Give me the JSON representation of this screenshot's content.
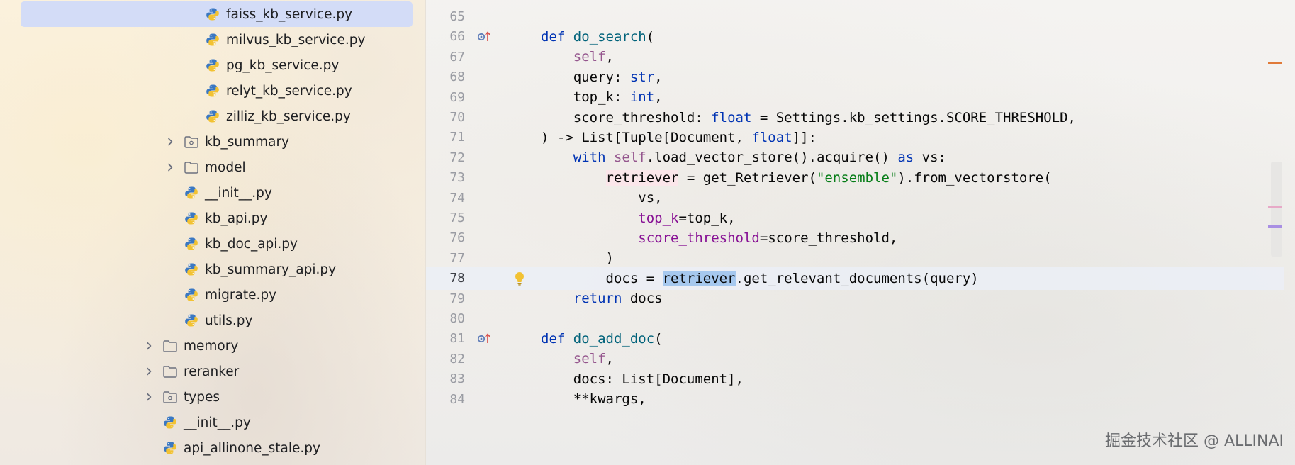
{
  "project_tree": {
    "items": [
      {
        "label": "faiss_kb_service.py",
        "kind": "python",
        "indent": 3,
        "selected": true
      },
      {
        "label": "milvus_kb_service.py",
        "kind": "python",
        "indent": 3
      },
      {
        "label": "pg_kb_service.py",
        "kind": "python",
        "indent": 3
      },
      {
        "label": "relyt_kb_service.py",
        "kind": "python",
        "indent": 3
      },
      {
        "label": "zilliz_kb_service.py",
        "kind": "python",
        "indent": 3
      },
      {
        "label": "kb_summary",
        "kind": "package",
        "indent": 2,
        "collapsed": true
      },
      {
        "label": "model",
        "kind": "folder",
        "indent": 2,
        "collapsed": true
      },
      {
        "label": "__init__.py",
        "kind": "python",
        "indent": 2
      },
      {
        "label": "kb_api.py",
        "kind": "python",
        "indent": 2
      },
      {
        "label": "kb_doc_api.py",
        "kind": "python",
        "indent": 2
      },
      {
        "label": "kb_summary_api.py",
        "kind": "python",
        "indent": 2
      },
      {
        "label": "migrate.py",
        "kind": "python",
        "indent": 2
      },
      {
        "label": "utils.py",
        "kind": "python",
        "indent": 2
      },
      {
        "label": "memory",
        "kind": "folder",
        "indent": 1,
        "collapsed": true
      },
      {
        "label": "reranker",
        "kind": "folder",
        "indent": 1,
        "collapsed": true
      },
      {
        "label": "types",
        "kind": "package",
        "indent": 1,
        "collapsed": true
      },
      {
        "label": "__init__.py",
        "kind": "python",
        "indent": 1
      },
      {
        "label": "api_allinone_stale.py",
        "kind": "python",
        "indent": 1
      }
    ]
  },
  "editor": {
    "current_line": "78",
    "lines": [
      {
        "num": "65",
        "gutter": "",
        "tokens": []
      },
      {
        "num": "66",
        "gutter": "override",
        "tokens": [
          [
            "kw",
            "def "
          ],
          [
            "fn",
            "do_search"
          ],
          [
            "",
            "("
          ]
        ]
      },
      {
        "num": "67",
        "gutter": "",
        "tokens": [
          [
            "",
            "    "
          ],
          [
            "self",
            "self"
          ],
          [
            "",
            ","
          ]
        ]
      },
      {
        "num": "68",
        "gutter": "",
        "tokens": [
          [
            "",
            "    query: "
          ],
          [
            "kw",
            "str"
          ],
          [
            "",
            ","
          ]
        ]
      },
      {
        "num": "69",
        "gutter": "",
        "tokens": [
          [
            "",
            "    top_k: "
          ],
          [
            "kw",
            "int"
          ],
          [
            "",
            ","
          ]
        ]
      },
      {
        "num": "70",
        "gutter": "",
        "tokens": [
          [
            "",
            "    score_threshold: "
          ],
          [
            "kw",
            "float"
          ],
          [
            "",
            " = Settings.kb_settings.SCORE_THRESHOLD,"
          ]
        ]
      },
      {
        "num": "71",
        "gutter": "",
        "tokens": [
          [
            "",
            ") -> List[Tuple[Document, "
          ],
          [
            "kw",
            "float"
          ],
          [
            "",
            "]]:"
          ]
        ]
      },
      {
        "num": "72",
        "gutter": "",
        "tokens": [
          [
            "",
            "    "
          ],
          [
            "kw",
            "with "
          ],
          [
            "self",
            "self"
          ],
          [
            "",
            ".load_vector_store().acquire() "
          ],
          [
            "kw",
            "as"
          ],
          [
            "",
            " vs:"
          ]
        ]
      },
      {
        "num": "73",
        "gutter": "",
        "tokens": [
          [
            "",
            "        "
          ],
          [
            "hl-write",
            "retriever"
          ],
          [
            "",
            " = get_Retriever("
          ],
          [
            "str",
            "\"ensemble\""
          ],
          [
            "",
            ").from_vectorstore("
          ]
        ]
      },
      {
        "num": "74",
        "gutter": "",
        "tokens": [
          [
            "",
            "            vs,"
          ]
        ]
      },
      {
        "num": "75",
        "gutter": "",
        "tokens": [
          [
            "",
            "            "
          ],
          [
            "param",
            "top_k"
          ],
          [
            "",
            "=top_k,"
          ]
        ]
      },
      {
        "num": "76",
        "gutter": "",
        "tokens": [
          [
            "",
            "            "
          ],
          [
            "param",
            "score_threshold"
          ],
          [
            "",
            "=score_threshold,"
          ]
        ]
      },
      {
        "num": "77",
        "gutter": "",
        "tokens": [
          [
            "",
            "        )"
          ]
        ]
      },
      {
        "num": "78",
        "gutter": "bulb",
        "tokens": [
          [
            "",
            "        docs = "
          ],
          [
            "hl",
            "retriever"
          ],
          [
            "",
            ".get_relevant_documents(query)"
          ]
        ]
      },
      {
        "num": "79",
        "gutter": "",
        "tokens": [
          [
            "",
            "    "
          ],
          [
            "kw",
            "return"
          ],
          [
            "",
            " docs"
          ]
        ]
      },
      {
        "num": "80",
        "gutter": "",
        "tokens": []
      },
      {
        "num": "81",
        "gutter": "override",
        "tokens": [
          [
            "kw",
            "def "
          ],
          [
            "fn",
            "do_add_doc"
          ],
          [
            "",
            "("
          ]
        ]
      },
      {
        "num": "82",
        "gutter": "",
        "tokens": [
          [
            "",
            "    "
          ],
          [
            "self",
            "self"
          ],
          [
            "",
            ","
          ]
        ]
      },
      {
        "num": "83",
        "gutter": "",
        "tokens": [
          [
            "",
            "    docs: List[Document],"
          ]
        ]
      },
      {
        "num": "84",
        "gutter": "",
        "tokens": [
          [
            "",
            "    **kwargs,"
          ]
        ]
      }
    ]
  },
  "marks": {
    "warning_color": "#e07a38",
    "usage_color": "#d98ab2",
    "write_color": "#9a7fd9"
  },
  "watermark": "掘金技术社区 @ ALLINAI"
}
